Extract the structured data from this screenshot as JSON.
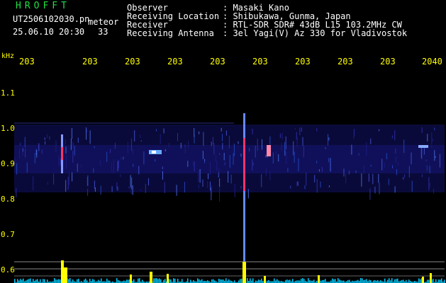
{
  "header": {
    "app_title": "HROFFT",
    "filename": "UT2506102030.pn",
    "meteor_tag": "meteor",
    "datetime": "25.06.10 20:30",
    "count": "33"
  },
  "info": [
    {
      "key": "Observer",
      "value": ": Masaki Kano"
    },
    {
      "key": "Receiving Location",
      "value": ": Shibukawa, Gunma, Japan"
    },
    {
      "key": "Receiver",
      "value": ": RTL-SDR SDR# 43dB L15 103.2MHz CW"
    },
    {
      "key": "Receiving Antenna",
      "value": ": 3el Yagi(V) Az 330 for Vladivostok"
    }
  ],
  "axis": {
    "unit": "kHz",
    "y_ticks": [
      "1.1",
      "1.0",
      "0.9",
      "0.8",
      "0.7",
      "0.6"
    ],
    "time_ticks": [
      "203",
      "203",
      "203",
      "203",
      "203",
      "203",
      "203",
      "203",
      "203",
      "2040"
    ]
  },
  "colors": {
    "text_green": "#22dd44",
    "text_white": "#ffffff",
    "text_yellow": "#ffff00",
    "background": "#000000",
    "echo_hot": "#ff3366",
    "level_bars": "#ffff00",
    "noise_floor": "#00ccff"
  }
}
